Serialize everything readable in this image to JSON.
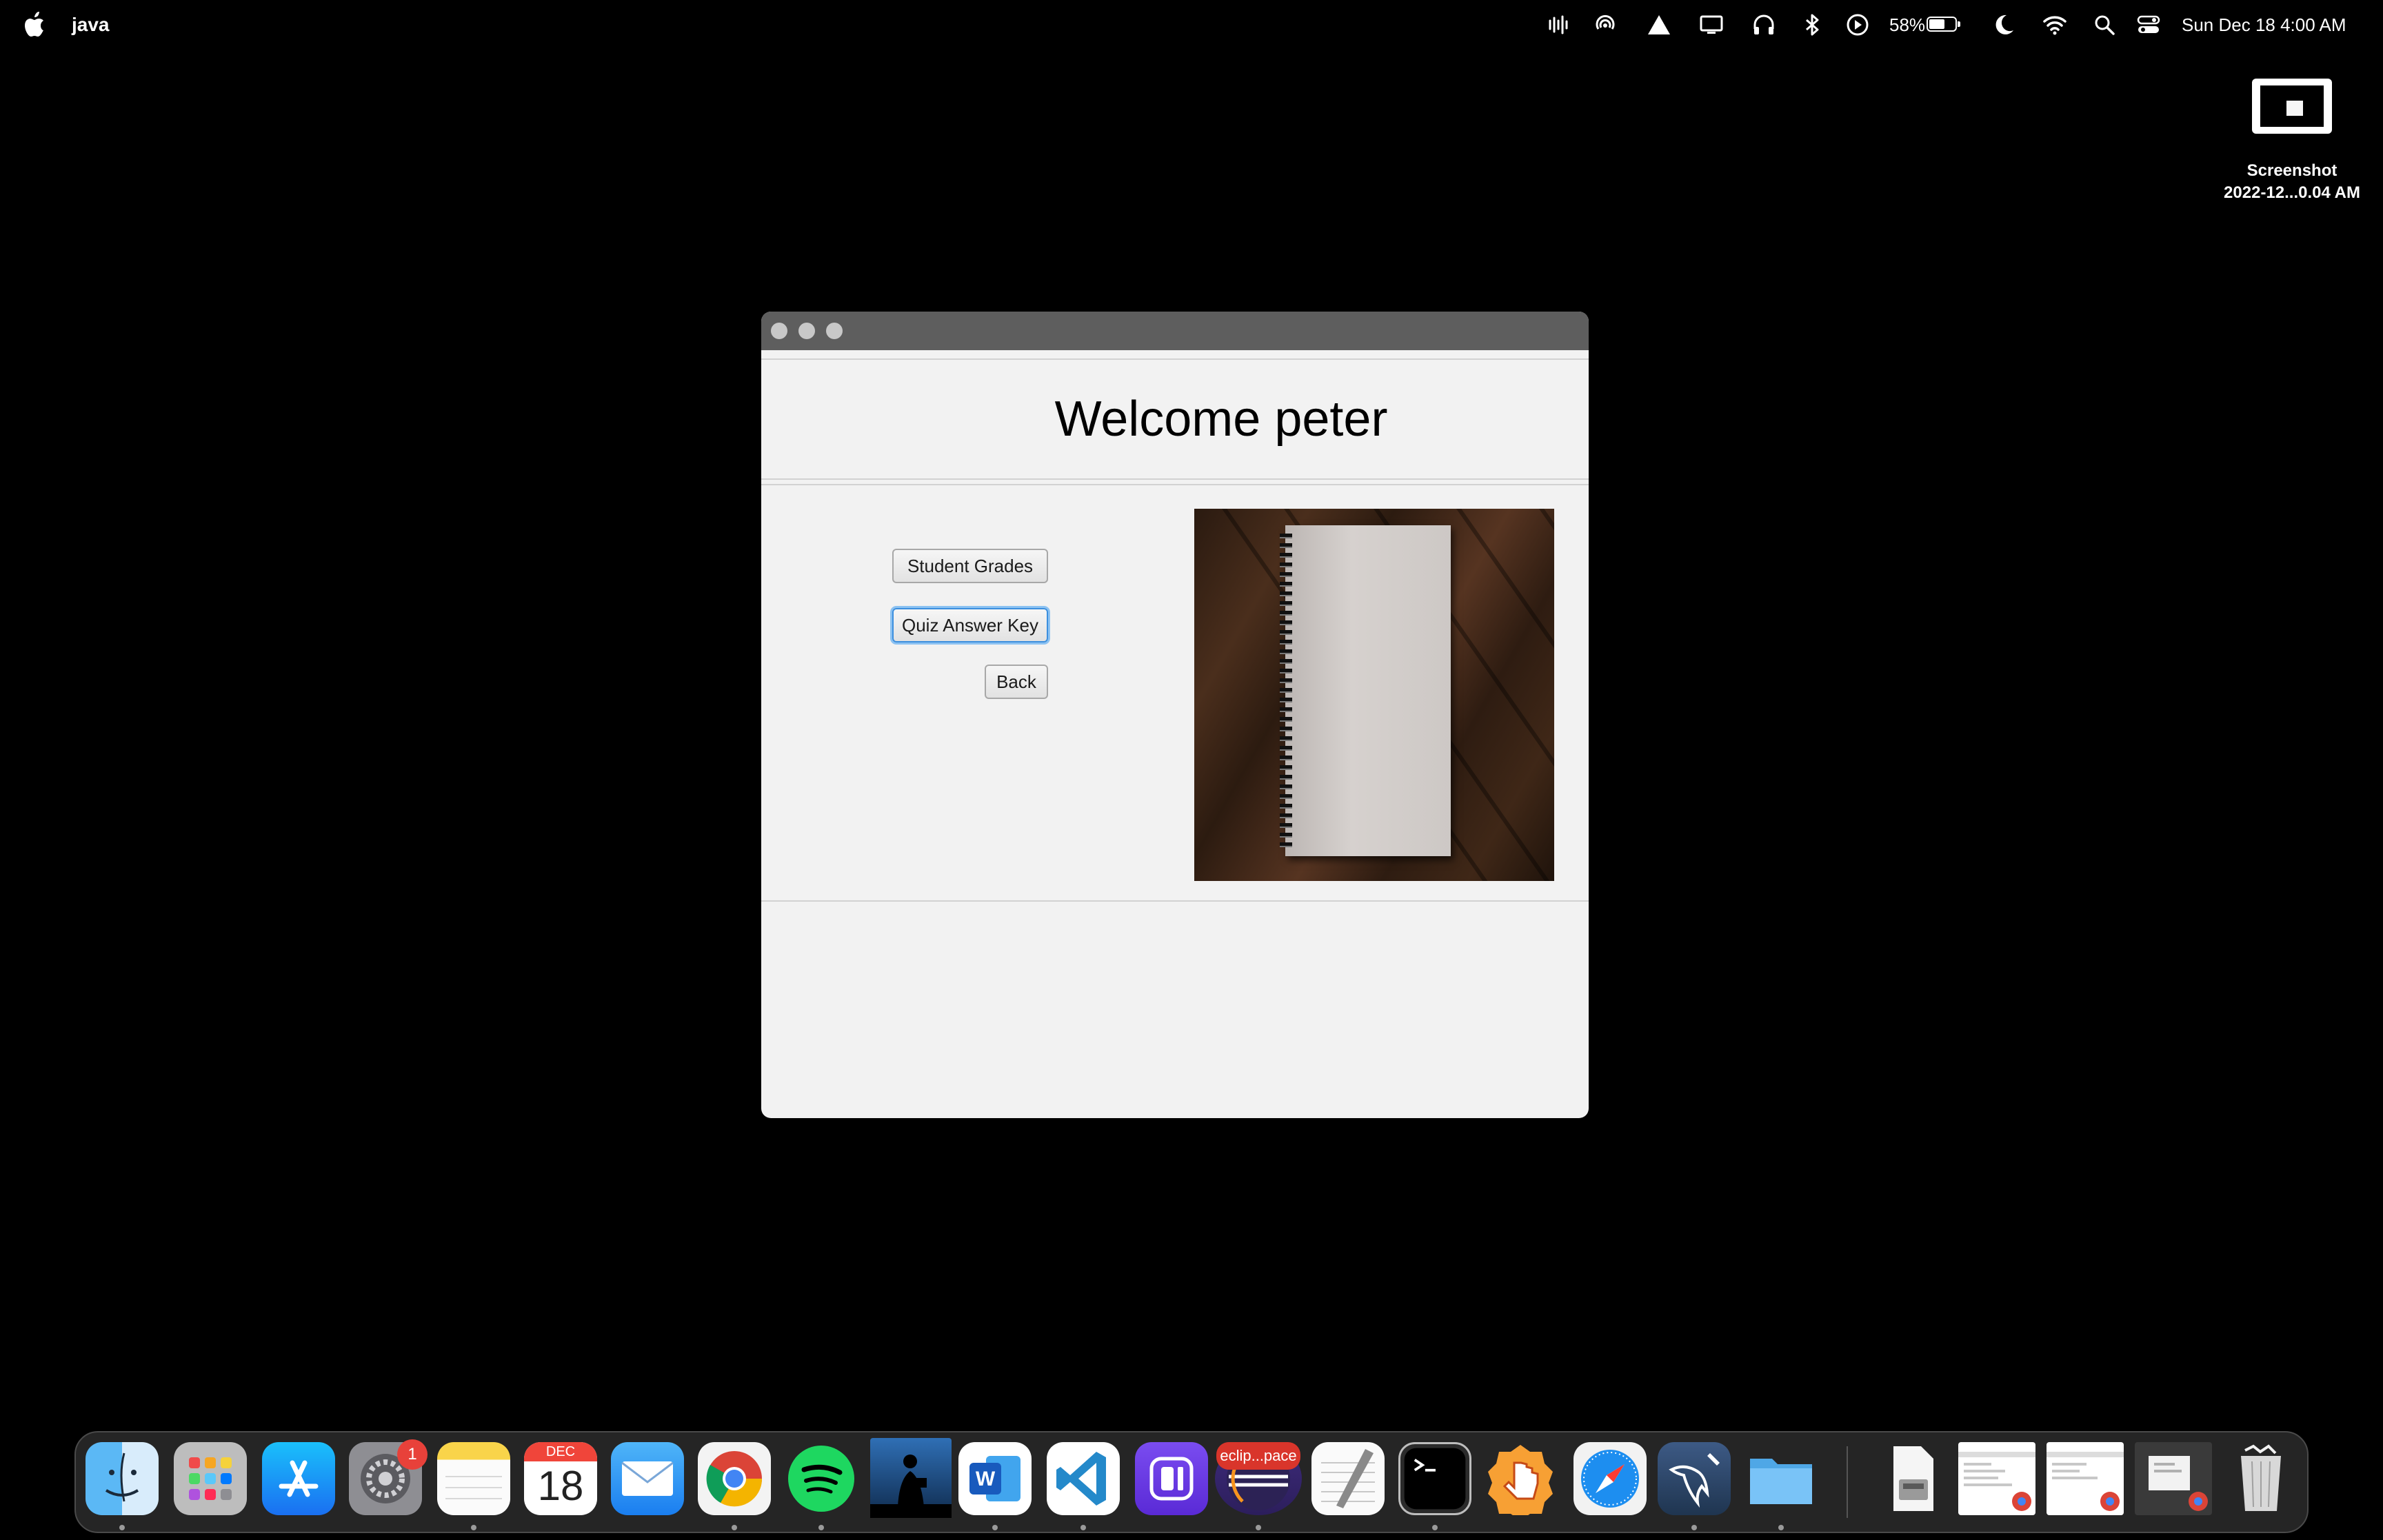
{
  "menubar": {
    "app_name": "java",
    "battery_percent": "58%",
    "battery_level": 0.58,
    "datetime": "Sun Dec 18  4:00 AM",
    "status_icons": [
      "audio-waveform-icon",
      "airdrop-icon",
      "vpn-triangle-icon",
      "display-icon",
      "headphones-icon",
      "bluetooth-icon",
      "now-playing-icon",
      "battery-icon",
      "focus-moon-icon",
      "wifi-icon",
      "spotlight-search-icon",
      "control-center-icon"
    ]
  },
  "desktop": {
    "file_label_line1": "Screenshot",
    "file_label_line2": "2022-12...0.04 AM"
  },
  "window": {
    "title": "",
    "welcome_text": "Welcome peter",
    "buttons": {
      "student_grades": "Student Grades",
      "quiz_answer_key": "Quiz Answer Key",
      "back": "Back"
    },
    "image_icon": "spiral-notebook-on-wood-photo"
  },
  "dock": {
    "apps": [
      {
        "name": "Finder",
        "icon": "finder-icon",
        "running": true
      },
      {
        "name": "Launchpad",
        "icon": "launchpad-icon",
        "running": false
      },
      {
        "name": "App Store",
        "icon": "app-store-icon",
        "running": false
      },
      {
        "name": "System Preferences",
        "icon": "settings-gear-icon",
        "running": false,
        "badge": "1"
      },
      {
        "name": "Notes",
        "icon": "notes-icon",
        "running": true
      },
      {
        "name": "Calendar",
        "icon": "calendar-icon",
        "running": false,
        "month": "DEC",
        "day": "18"
      },
      {
        "name": "Mail",
        "icon": "mail-icon",
        "running": false
      },
      {
        "name": "Chrome",
        "icon": "chrome-icon",
        "running": true
      },
      {
        "name": "Spotify",
        "icon": "spotify-icon",
        "running": true
      },
      {
        "name": "Kindle",
        "icon": "kindle-icon",
        "running": false
      },
      {
        "name": "Word",
        "icon": "word-icon",
        "running": true
      },
      {
        "name": "VS Code",
        "icon": "vscode-icon",
        "running": true
      },
      {
        "name": "Xcode Simulator",
        "icon": "simulator-icon",
        "running": false
      },
      {
        "name": "Eclipse",
        "icon": "eclipse-icon",
        "running": true,
        "tag": "eclip...pace"
      },
      {
        "name": "TextEdit",
        "icon": "textedit-icon",
        "running": false
      },
      {
        "name": "Terminal",
        "icon": "terminal-icon",
        "running": true
      },
      {
        "name": "Toolbox",
        "icon": "hand-pointer-icon",
        "running": false
      },
      {
        "name": "Safari",
        "icon": "safari-icon",
        "running": false
      },
      {
        "name": "MySQL Workbench",
        "icon": "mysql-dolphin-icon",
        "running": true
      },
      {
        "name": "Folder",
        "icon": "folder-icon",
        "running": true
      }
    ],
    "recents": [
      {
        "name": "Disk Image",
        "icon": "disk-image-icon"
      },
      {
        "name": "Chrome Window 1",
        "icon": "chrome-window-thumbnail-icon"
      },
      {
        "name": "Chrome Window 2",
        "icon": "chrome-window-thumbnail-icon"
      },
      {
        "name": "Chrome Window 3",
        "icon": "chrome-window-thumbnail-icon"
      }
    ],
    "trash": {
      "name": "Trash",
      "icon": "trash-icon"
    }
  }
}
